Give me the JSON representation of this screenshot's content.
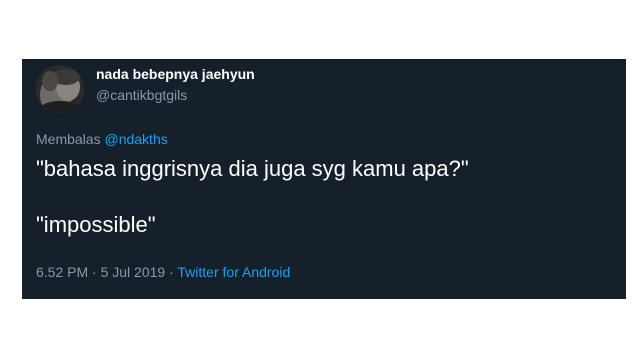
{
  "tweet": {
    "author": {
      "display_name": "nada bebepnya jaehyun",
      "handle": "@cantikbgtgils"
    },
    "reply_to": {
      "prefix": "Membalas",
      "mention": "@ndakths"
    },
    "text": {
      "line1": "\"bahasa inggrisnya dia juga syg kamu apa?\"",
      "line2": "\"impossible\""
    },
    "meta": {
      "time": "6.52 PM",
      "separator": "·",
      "date": "5 Jul 2019",
      "source": "Twitter for Android"
    }
  },
  "colors": {
    "background": "#15202b",
    "text": "#ffffff",
    "secondary": "#8899a6",
    "link": "#1da1f2"
  },
  "icons": [
    "avatar-image"
  ]
}
